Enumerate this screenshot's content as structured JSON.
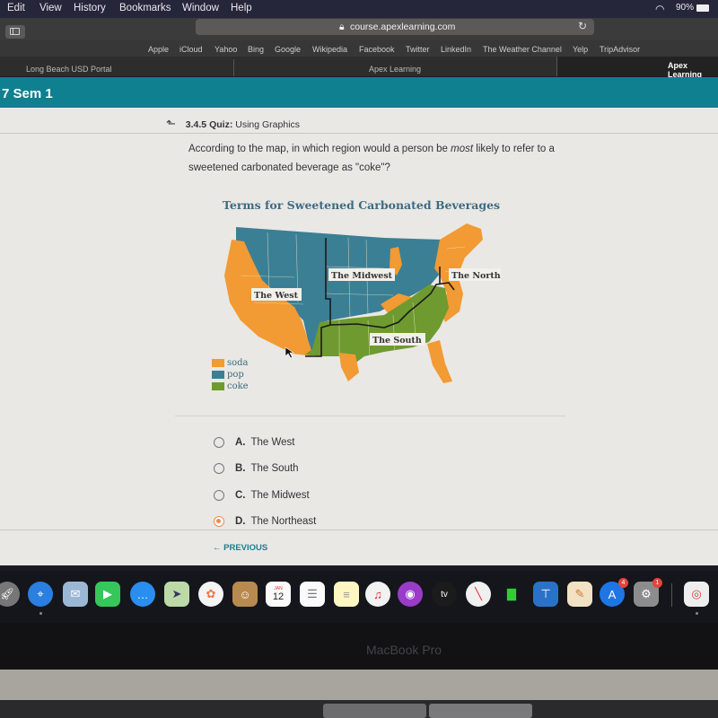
{
  "menubar": {
    "items": [
      "Edit",
      "View",
      "History",
      "Bookmarks",
      "Window",
      "Help"
    ],
    "battery": "90%",
    "wifi_icon": "wifi-icon",
    "battery_icon": "battery-icon"
  },
  "browser": {
    "url": "course.apexlearning.com",
    "bookmarks": [
      "Apple",
      "iCloud",
      "Yahoo",
      "Bing",
      "Google",
      "Wikipedia",
      "Facebook",
      "Twitter",
      "LinkedIn",
      "The Weather Channel",
      "Yelp",
      "TripAdvisor"
    ],
    "tabs": [
      "Long Beach USD Portal",
      "Apex Learning",
      "Apex Learning"
    ]
  },
  "course": {
    "title": "7 Sem 1"
  },
  "quiz": {
    "number": "3.4.5",
    "type": "Quiz:",
    "name": "Using Graphics",
    "question_part1": "According to the map, in which region would a person be ",
    "question_emphasis": "most",
    "question_part2": " likely to refer to a sweetened carbonated beverage as \"coke\"?",
    "options": [
      {
        "letter": "A.",
        "text": "The West",
        "selected": false
      },
      {
        "letter": "B.",
        "text": "The South",
        "selected": false
      },
      {
        "letter": "C.",
        "text": "The Midwest",
        "selected": false
      },
      {
        "letter": "D.",
        "text": "The Northeast",
        "selected": true
      }
    ],
    "previous_label": "PREVIOUS"
  },
  "map": {
    "title": "Terms for Sweetened Carbonated Beverages",
    "regions": [
      "The West",
      "The Midwest",
      "The Northeast",
      "The South"
    ],
    "legend": [
      {
        "label": "soda",
        "color": "#f29a33"
      },
      {
        "label": "pop",
        "color": "#3b7f95"
      },
      {
        "label": "coke",
        "color": "#6e9a2f"
      }
    ]
  },
  "dock": {
    "apps": [
      "launchpad",
      "safari",
      "mail",
      "facetime",
      "messages",
      "maps",
      "photos",
      "contacts",
      "calendar",
      "reminders",
      "notes",
      "music",
      "podcasts",
      "tv",
      "news",
      "numbers",
      "keynote",
      "pages",
      "app-store",
      "system-preferences",
      "chrome"
    ],
    "calendar_day": "12",
    "calendar_month": "JAN",
    "tv_label": "tv",
    "app_store_badge": "4",
    "system_prefs_badge": "1"
  },
  "device": {
    "model": "MacBook Pro"
  }
}
